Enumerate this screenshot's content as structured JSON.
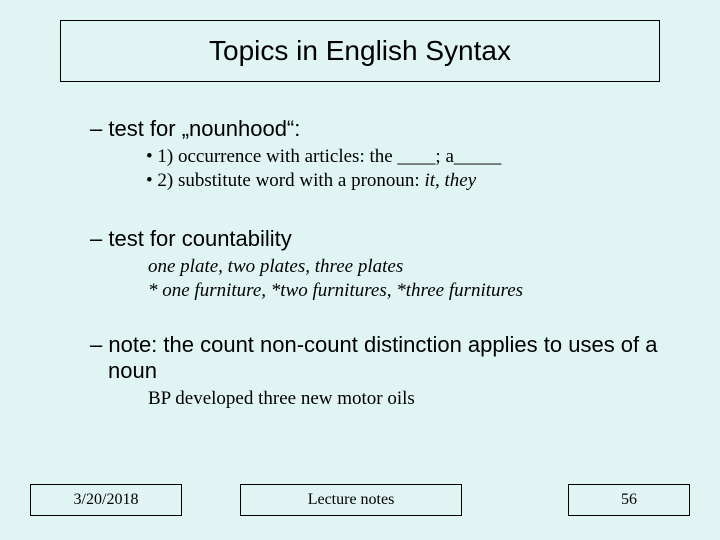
{
  "title": "Topics in English Syntax",
  "items": {
    "d1": "test for „nounhood“:",
    "b1": "1) occurrence with articles: the  ____;   a_____",
    "b2_a": "2) substitute word with a pronoun: ",
    "b2_b": "it, they",
    "d2": " test for countability",
    "ex1": "one plate, two plates, three plates",
    "ex2": "* one furniture, *two furnitures, *three furnitures",
    "d3": "note: the count non-count distinction applies to uses of a noun",
    "ex3": "BP developed three new motor oils"
  },
  "footer": {
    "date": "3/20/2018",
    "center": "Lecture notes",
    "page": "56"
  }
}
